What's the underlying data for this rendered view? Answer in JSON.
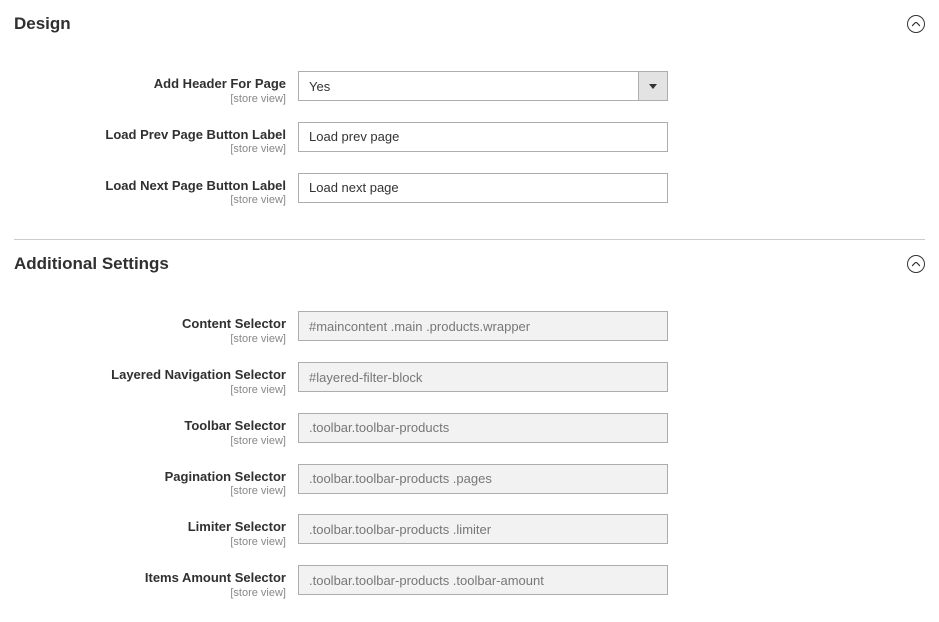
{
  "scope_label": "[store view]",
  "sections": {
    "design": {
      "title": "Design",
      "fields": {
        "add_header": {
          "label": "Add Header For Page",
          "value": "Yes"
        },
        "prev_label": {
          "label": "Load Prev Page Button Label",
          "value": "Load prev page"
        },
        "next_label": {
          "label": "Load Next Page Button Label",
          "value": "Load next page"
        }
      }
    },
    "additional": {
      "title": "Additional Settings",
      "fields": {
        "content_selector": {
          "label": "Content Selector",
          "value": "#maincontent .main .products.wrapper"
        },
        "layered_nav_selector": {
          "label": "Layered Navigation Selector",
          "value": "#layered-filter-block"
        },
        "toolbar_selector": {
          "label": "Toolbar Selector",
          "value": ".toolbar.toolbar-products"
        },
        "pagination_selector": {
          "label": "Pagination Selector",
          "value": ".toolbar.toolbar-products .pages"
        },
        "limiter_selector": {
          "label": "Limiter Selector",
          "value": ".toolbar.toolbar-products .limiter"
        },
        "items_amount_selector": {
          "label": "Items Amount Selector",
          "value": ".toolbar.toolbar-products .toolbar-amount"
        }
      }
    }
  }
}
